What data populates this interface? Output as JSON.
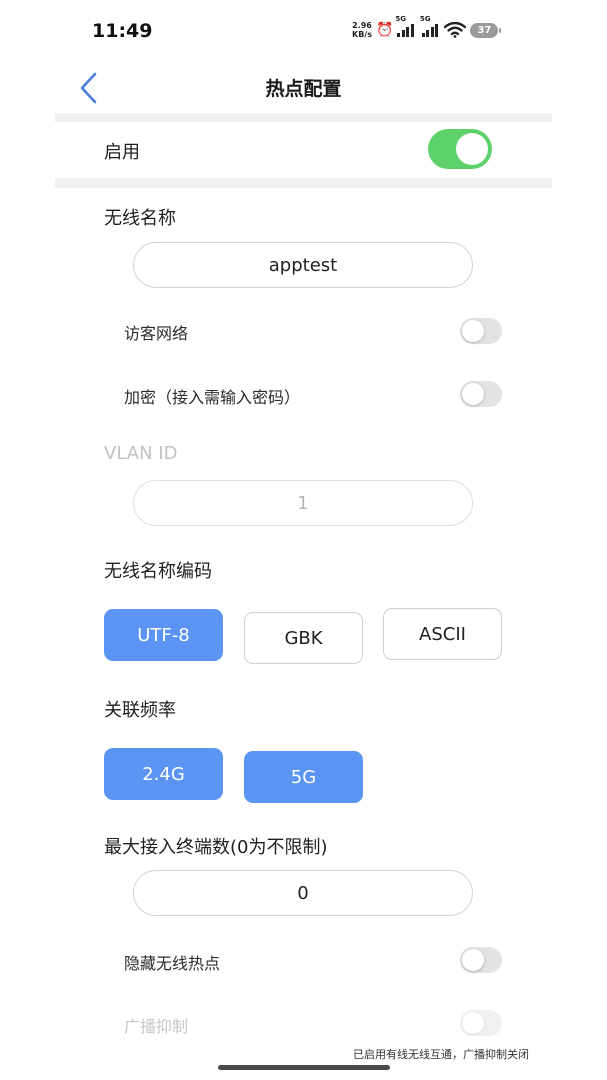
{
  "status_bar": {
    "time": "11:49",
    "net_speed_value": "2.96",
    "net_speed_unit": "KB/s",
    "sim1_tag": "5G",
    "sim2_tag": "5G",
    "battery": "37"
  },
  "header": {
    "title": "热点配置"
  },
  "enable": {
    "label": "启用",
    "on": true,
    "accent_color": "#5fd16b"
  },
  "ssid": {
    "label": "无线名称",
    "value": "apptest"
  },
  "guest_network": {
    "label": "访客网络",
    "on": false
  },
  "encryption": {
    "label": "加密（接入需输入密码）",
    "on": false
  },
  "vlan": {
    "label": "VLAN ID",
    "value": "1",
    "disabled": true
  },
  "ssid_encoding": {
    "label": "无线名称编码",
    "options": [
      "UTF-8",
      "GBK",
      "ASCII"
    ],
    "selected": "UTF-8"
  },
  "band": {
    "label": "关联频率",
    "options": [
      "2.4G",
      "5G"
    ],
    "selected": [
      "2.4G",
      "5G"
    ]
  },
  "max_clients": {
    "label": "最大接入终端数(0为不限制)",
    "value": "0"
  },
  "hide_ssid": {
    "label": "隐藏无线热点",
    "on": false
  },
  "broadcast_suppression": {
    "label": "广播抑制",
    "on": false,
    "disabled": true
  },
  "footer_note": "已启用有线无线互通，广播抑制关闭",
  "colors": {
    "selected_button": "#5b94f3",
    "back_arrow": "#4a7fdc"
  }
}
